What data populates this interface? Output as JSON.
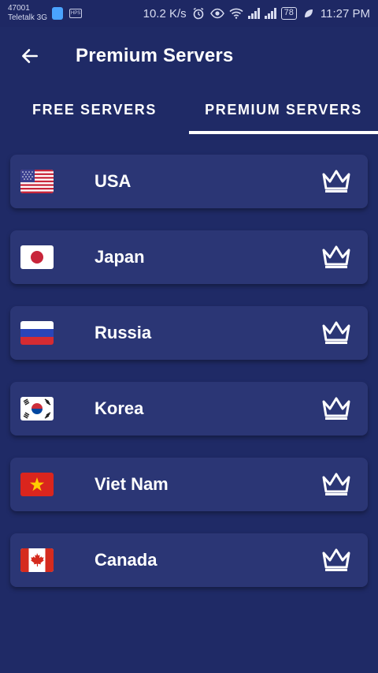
{
  "status_bar": {
    "carrier_code": "47001",
    "carrier_name": "Teletalk 3G",
    "app_badge_1": "shield-icon",
    "app_badge_2": "HPS",
    "net_speed": "10.2 K/s",
    "battery": "78",
    "time": "11:27 PM"
  },
  "toolbar": {
    "back_icon": "arrow-left-icon",
    "title": "Premium Servers"
  },
  "tabs": [
    {
      "label": "FREE SERVERS",
      "active": false
    },
    {
      "label": "PREMIUM SERVERS",
      "active": true
    }
  ],
  "servers": [
    {
      "name": "USA",
      "flag": "usa-flag-icon",
      "badge": "crown-icon"
    },
    {
      "name": "Japan",
      "flag": "japan-flag-icon",
      "badge": "crown-icon"
    },
    {
      "name": "Russia",
      "flag": "russia-flag-icon",
      "badge": "crown-icon"
    },
    {
      "name": "Korea",
      "flag": "korea-flag-icon",
      "badge": "crown-icon"
    },
    {
      "name": "Viet Nam",
      "flag": "vietnam-flag-icon",
      "badge": "crown-icon"
    },
    {
      "name": "Canada",
      "flag": "canada-flag-icon",
      "badge": "crown-icon"
    }
  ],
  "colors": {
    "background": "#1f2a66",
    "card": "#2b3675",
    "text": "#ffffff",
    "tab_indicator": "#ffffff"
  }
}
